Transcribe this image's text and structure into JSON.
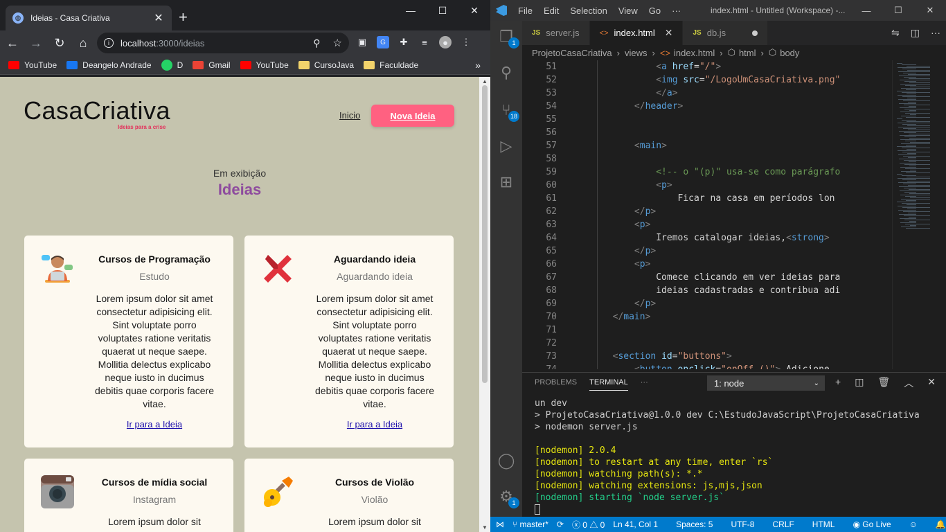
{
  "browser": {
    "tab_title": "Ideias - Casa Criativa",
    "url_host": "localhost",
    "url_rest": ":3000/ideias",
    "bookmarks": [
      "YouTube",
      "Deangelo Andrade",
      "D",
      "Gmail",
      "YouTube",
      "CursoJava",
      "Faculdade"
    ]
  },
  "page": {
    "logo": "CasaCriativa",
    "logo_tagline": "Ideias para a crise",
    "nav_home": "Inicio",
    "new_idea_button": "Nova Ideia",
    "subtitle": "Em exibição",
    "headline": "Ideias",
    "cards": [
      {
        "title": "Cursos de Programação",
        "category": "Estudo",
        "description": "Lorem ipsum dolor sit amet consectetur adipisicing elit. Sint voluptate porro voluptates ratione veritatis quaerat ut neque saepe. Mollitia delectus explicabo neque iusto in ducimus debitis quae corporis facere vitae.",
        "link": "Ir para a Ideia",
        "icon": "programmer-icon"
      },
      {
        "title": "Aguardando ideia",
        "category": "Aguardando ideia",
        "description": "Lorem ipsum dolor sit amet consectetur adipisicing elit. Sint voluptate porro voluptates ratione veritatis quaerat ut neque saepe. Mollitia delectus explicabo neque iusto in ducimus debitis quae corporis facere vitae.",
        "link": "Ir para a Ideia",
        "icon": "red-x-icon"
      },
      {
        "title": "Cursos de mídia social",
        "category": "Instagram",
        "description": "Lorem ipsum dolor sit",
        "link": "",
        "icon": "instagram-icon"
      },
      {
        "title": "Cursos de Violão",
        "category": "Violão",
        "description": "Lorem ipsum dolor sit",
        "link": "",
        "icon": "guitar-icon"
      }
    ]
  },
  "vscode": {
    "menu": [
      "File",
      "Edit",
      "Selection",
      "View",
      "Go",
      "···"
    ],
    "window_title": "index.html - Untitled (Workspace) -...",
    "tabs": [
      "server.js",
      "index.html",
      "db.js"
    ],
    "breadcrumb": [
      "ProjetoCasaCriativa",
      "views",
      "index.html",
      "html",
      "body"
    ],
    "explorer_badge": "1",
    "scm_badge": "18",
    "code_lines": [
      {
        "n": "51",
        "t": "                <a href=\"/\">"
      },
      {
        "n": "52",
        "t": "                <img src=\"/LogoUmCasaCriativa.png\""
      },
      {
        "n": "53",
        "t": "                </a>"
      },
      {
        "n": "54",
        "t": "            </header>"
      },
      {
        "n": "55",
        "t": ""
      },
      {
        "n": "56",
        "t": ""
      },
      {
        "n": "57",
        "t": "            <main>"
      },
      {
        "n": "58",
        "t": ""
      },
      {
        "n": "59",
        "t": "                <!-- o \"(p)\" usa-se como parágrafo"
      },
      {
        "n": "60",
        "t": "                <p>"
      },
      {
        "n": "61",
        "t": "                    Ficar na casa em períodos lon"
      },
      {
        "n": "62",
        "t": "            </p>"
      },
      {
        "n": "63",
        "t": "            <p>"
      },
      {
        "n": "64",
        "t": "                Iremos catalogar ideias,<strong> "
      },
      {
        "n": "65",
        "t": "            </p>"
      },
      {
        "n": "66",
        "t": "            <p>"
      },
      {
        "n": "67",
        "t": "                Comece clicando em ver ideias para"
      },
      {
        "n": "68",
        "t": "                ideias cadastradas e contribua adi"
      },
      {
        "n": "69",
        "t": "            </p>"
      },
      {
        "n": "70",
        "t": "        </main>"
      },
      {
        "n": "71",
        "t": ""
      },
      {
        "n": "72",
        "t": ""
      },
      {
        "n": "73",
        "t": "        <section id=\"buttons\">"
      },
      {
        "n": "74",
        "t": "            <button onclick=\"onOff ()\"> Adicione"
      }
    ],
    "panel_tabs": [
      "PROBLEMS",
      "TERMINAL",
      "···"
    ],
    "terminal_select": "1: node",
    "terminal_lines": [
      {
        "c": "w",
        "t": "un dev"
      },
      {
        "c": "w",
        "t": "> ProjetoCasaCriativa@1.0.0 dev C:\\EstudoJavaScript\\ProjetoCasaCriativa"
      },
      {
        "c": "w",
        "t": "> nodemon server.js"
      },
      {
        "c": "w",
        "t": ""
      },
      {
        "c": "y",
        "t": "[nodemon] 2.0.4"
      },
      {
        "c": "y",
        "t": "[nodemon] to restart at any time, enter `rs`"
      },
      {
        "c": "y",
        "t": "[nodemon] watching path(s): *.*"
      },
      {
        "c": "y",
        "t": "[nodemon] watching extensions: js,mjs,json"
      },
      {
        "c": "g",
        "t": "[nodemon] starting `node server.js`"
      }
    ],
    "status": {
      "branch": "master*",
      "errors": "0",
      "warnings": "0",
      "position": "Ln 41, Col 1",
      "spaces": "Spaces: 5",
      "encoding": "UTF-8",
      "eol": "CRLF",
      "language": "HTML",
      "golive": "Go Live"
    }
  }
}
